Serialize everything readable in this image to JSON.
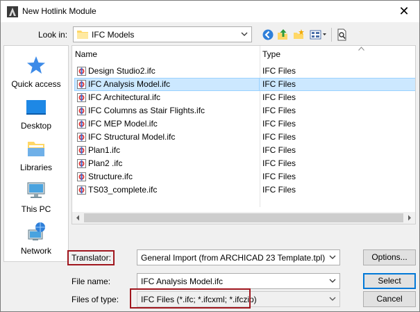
{
  "window": {
    "title": "New Hotlink Module",
    "close_glyph": "✕"
  },
  "lookin": {
    "label": "Look in:",
    "value": "IFC Models"
  },
  "toolbar": {
    "icons": [
      "back-icon",
      "up-folder-icon",
      "new-folder-icon",
      "view-menu-icon",
      "preview-icon"
    ]
  },
  "places": [
    {
      "label": "Quick access",
      "icon": "quick-access-icon"
    },
    {
      "label": "Desktop",
      "icon": "desktop-icon"
    },
    {
      "label": "Libraries",
      "icon": "libraries-icon"
    },
    {
      "label": "This PC",
      "icon": "this-pc-icon"
    },
    {
      "label": "Network",
      "icon": "network-icon"
    }
  ],
  "filelist": {
    "columns": [
      "Name",
      "Type"
    ],
    "rows": [
      {
        "name": "Design Studio2.ifc",
        "type": "IFC Files",
        "selected": false
      },
      {
        "name": "IFC Analysis Model.ifc",
        "type": "IFC Files",
        "selected": true
      },
      {
        "name": "IFC Architectural.ifc",
        "type": "IFC Files",
        "selected": false
      },
      {
        "name": "IFC Columns as Stair Flights.ifc",
        "type": "IFC Files",
        "selected": false
      },
      {
        "name": "IFC MEP Model.ifc",
        "type": "IFC Files",
        "selected": false
      },
      {
        "name": "IFC Structural Model.ifc",
        "type": "IFC Files",
        "selected": false
      },
      {
        "name": "Plan1.ifc",
        "type": "IFC Files",
        "selected": false
      },
      {
        "name": "Plan2 .ifc",
        "type": "IFC Files",
        "selected": false
      },
      {
        "name": "Structure.ifc",
        "type": "IFC Files",
        "selected": false
      },
      {
        "name": "TS03_complete.ifc",
        "type": "IFC Files",
        "selected": false
      }
    ]
  },
  "translator": {
    "label": "Translator:",
    "value": "General Import (from ARCHICAD 23 Template.tpl)",
    "options_button": "Options..."
  },
  "filename": {
    "label": "File name:",
    "value": "IFC Analysis Model.ifc",
    "select_button": "Select"
  },
  "filetype": {
    "label": "Files of type:",
    "value": "IFC Files (*.ifc; *.ifcxml; *.ifczip)",
    "cancel_button": "Cancel"
  },
  "colors": {
    "highlight": "#a0161e",
    "selection": "#cce8ff",
    "accent": "#0078d7"
  }
}
